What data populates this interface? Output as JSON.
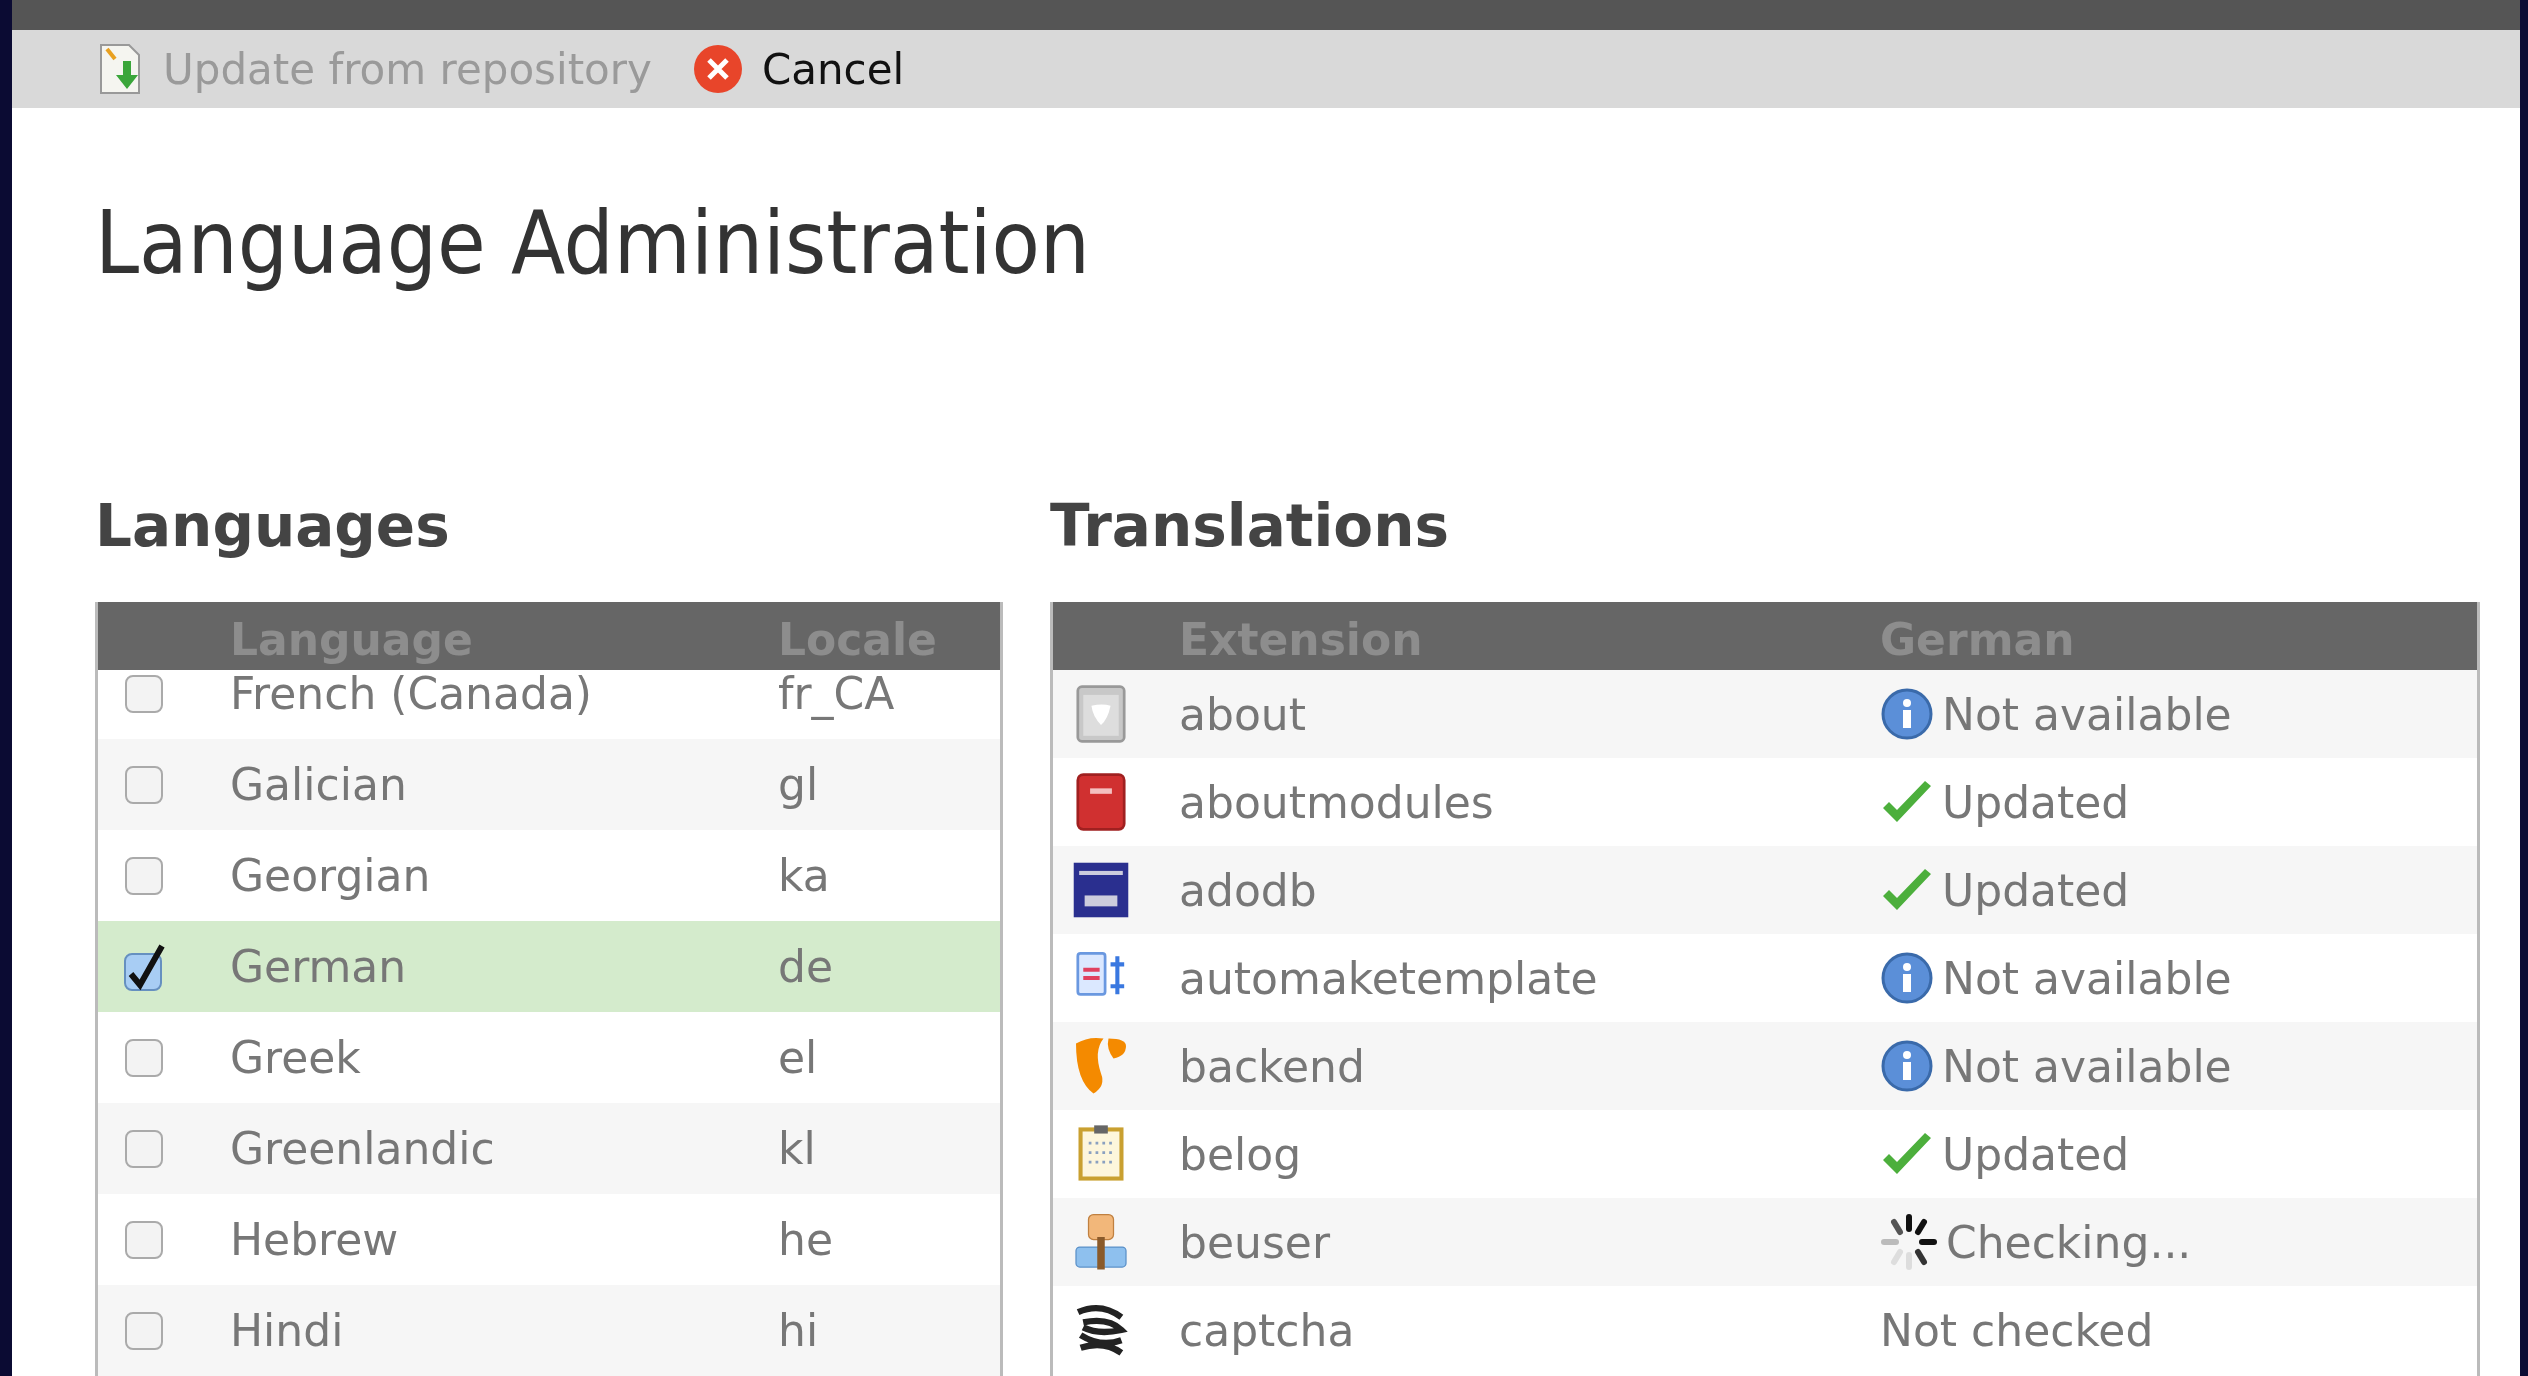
{
  "toolbar": {
    "buttons": [
      {
        "label": "Update from repository",
        "disabled": true
      },
      {
        "label": "Cancel",
        "disabled": false
      }
    ]
  },
  "title": "Language Administration",
  "languages": {
    "heading": "Languages",
    "columns": [
      "Language",
      "Locale"
    ],
    "rows": [
      {
        "name": "French (Canada)",
        "locale": "fr_CA",
        "checked": false
      },
      {
        "name": "Galician",
        "locale": "gl",
        "checked": false
      },
      {
        "name": "Georgian",
        "locale": "ka",
        "checked": false
      },
      {
        "name": "German",
        "locale": "de",
        "checked": true
      },
      {
        "name": "Greek",
        "locale": "el",
        "checked": false
      },
      {
        "name": "Greenlandic",
        "locale": "kl",
        "checked": false
      },
      {
        "name": "Hebrew",
        "locale": "he",
        "checked": false
      },
      {
        "name": "Hindi",
        "locale": "hi",
        "checked": false
      }
    ]
  },
  "translations": {
    "heading": "Translations",
    "columns": [
      "Extension",
      "German"
    ],
    "rows": [
      {
        "extension": "about",
        "status": "Not available",
        "kind": "info"
      },
      {
        "extension": "aboutmodules",
        "status": "Updated",
        "kind": "updated"
      },
      {
        "extension": "adodb",
        "status": "Updated",
        "kind": "updated"
      },
      {
        "extension": "automaketemplate",
        "status": "Not available",
        "kind": "info"
      },
      {
        "extension": "backend",
        "status": "Not available",
        "kind": "info"
      },
      {
        "extension": "belog",
        "status": "Updated",
        "kind": "updated"
      },
      {
        "extension": "beuser",
        "status": "Checking...",
        "kind": "checking"
      },
      {
        "extension": "captcha",
        "status": "Not checked",
        "kind": "plain"
      }
    ]
  }
}
